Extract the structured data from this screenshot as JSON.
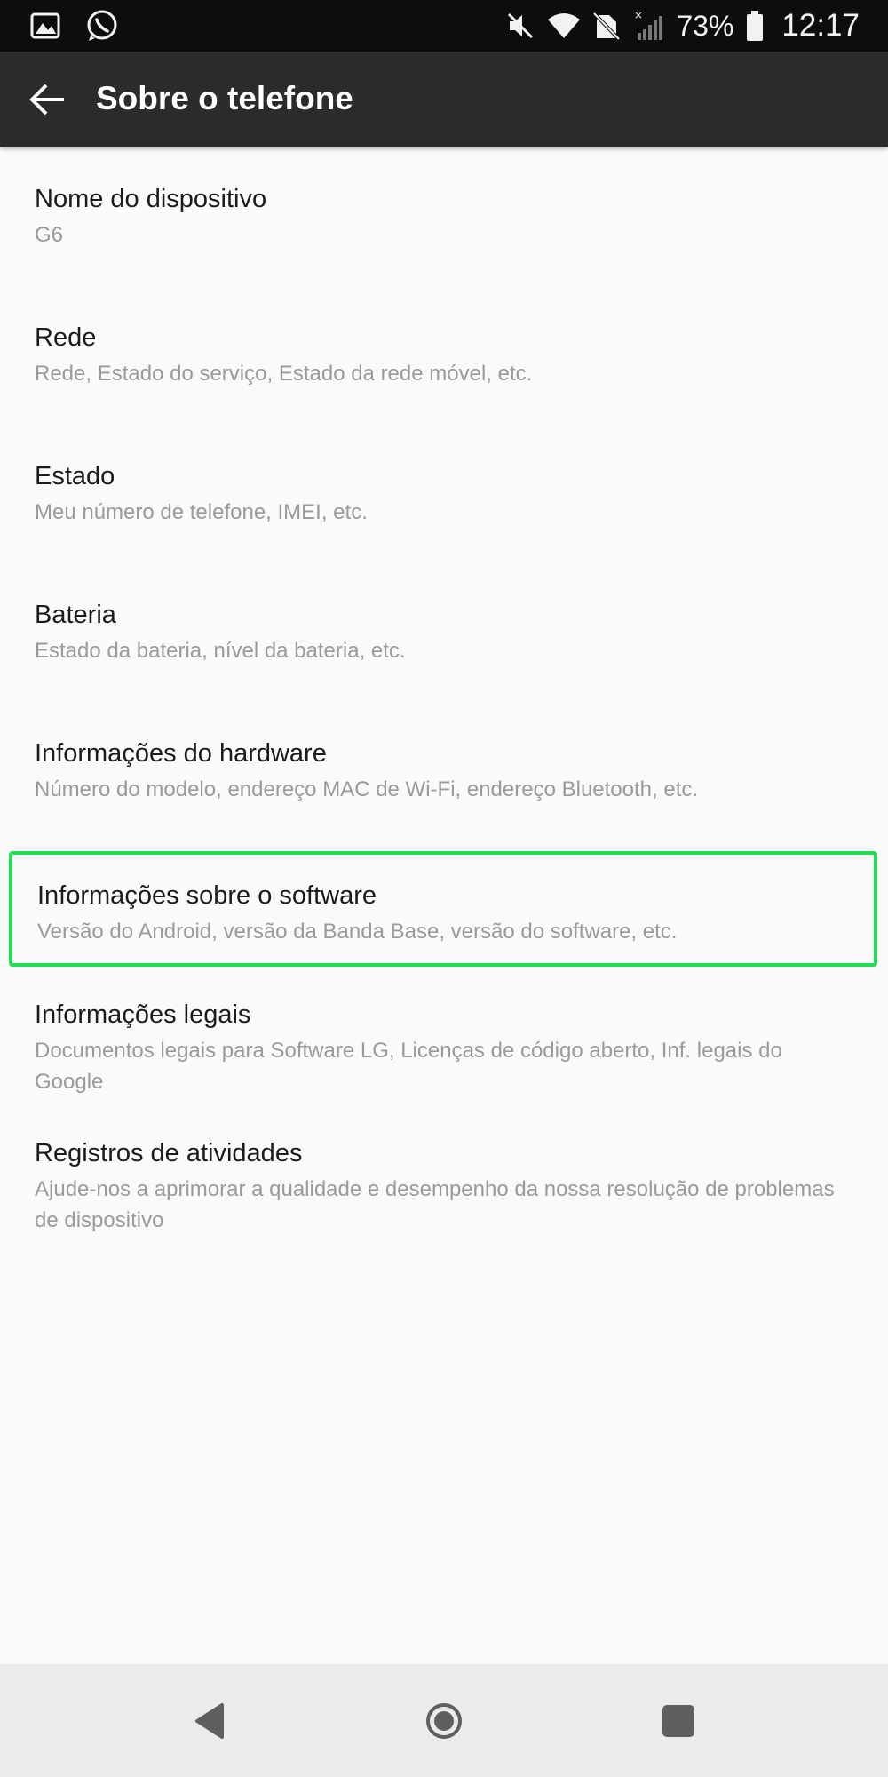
{
  "status_bar": {
    "battery_percent": "73%",
    "time": "12:17",
    "icons": [
      "gallery-icon",
      "whatsapp-icon",
      "mute-icon",
      "wifi-icon",
      "no-sim-icon",
      "signal-icon",
      "battery-icon"
    ]
  },
  "toolbar": {
    "title": "Sobre o telefone",
    "back_icon": "arrow-back-icon"
  },
  "list": {
    "items": [
      {
        "title": "Nome do dispositivo",
        "subtitle": "G6"
      },
      {
        "title": "Rede",
        "subtitle": "Rede, Estado do serviço, Estado da rede móvel, etc."
      },
      {
        "title": "Estado",
        "subtitle": "Meu número de telefone, IMEI, etc."
      },
      {
        "title": "Bateria",
        "subtitle": "Estado da bateria, nível da bateria, etc."
      },
      {
        "title": "Informações do hardware",
        "subtitle": "Número do modelo, endereço MAC de Wi-Fi, endereço Bluetooth, etc."
      },
      {
        "title": "Informações sobre o software",
        "subtitle": "Versão do Android, versão da Banda Base, versão do software, etc.",
        "highlighted": true
      },
      {
        "title": "Informações legais",
        "subtitle": "Documentos legais para Software LG, Licenças de código aberto, Inf. legais do Google"
      },
      {
        "title": "Registros de atividades",
        "subtitle": "Ajude-nos a aprimorar a qualidade e desempenho da nossa resolução de problemas de dispositivo"
      }
    ]
  },
  "nav_bar": {
    "icons": [
      "back-icon",
      "home-icon",
      "recents-icon"
    ]
  },
  "colors": {
    "status_bar": "#0d0d0d",
    "toolbar": "#2b2b2b",
    "background": "#fafafa",
    "highlight": "#22dd55",
    "nav_bar": "#e9ebed"
  }
}
